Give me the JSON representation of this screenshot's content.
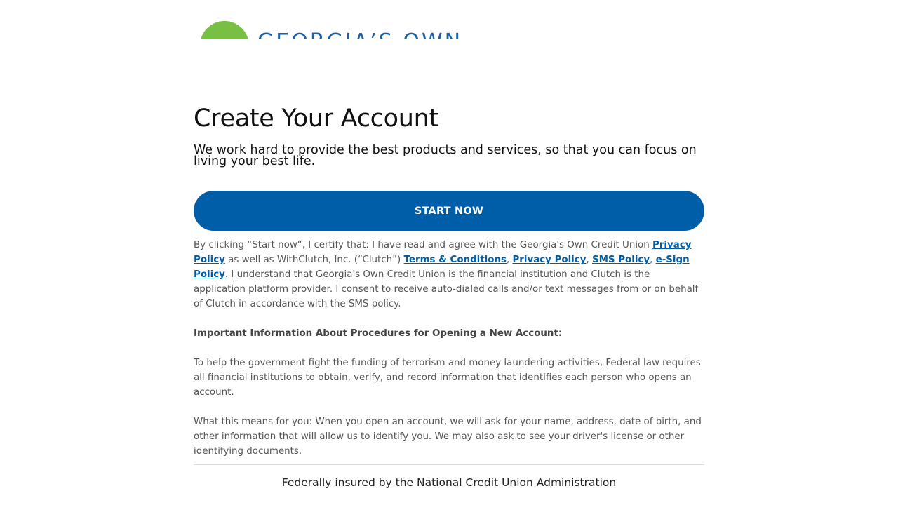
{
  "brand": {
    "logo_text": "GEORGIA’S OWN",
    "logo_circle_color": "#78c043",
    "logo_text_color": "#1d5fa6"
  },
  "page": {
    "title": "Create Your Account",
    "subtitle": "We work hard to provide the best products and services, so that you can focus on living your best life."
  },
  "cta": {
    "label": "START NOW",
    "color": "#005ea8"
  },
  "consent": {
    "text_1": "By clicking “Start now“, I certify that: I have read and agree with the Georgia's Own Credit Union ",
    "link_privacy_gocu": "Privacy Policy",
    "text_2": " as well as WithClutch, Inc. (“Clutch”) ",
    "link_terms": "Terms & Conditions",
    "sep_1": ", ",
    "link_privacy_clutch": "Privacy Policy",
    "sep_2": ", ",
    "link_sms": "SMS Policy",
    "sep_3": ", ",
    "link_esign": "e-Sign Policy",
    "text_3": ". I understand that Georgia's Own Credit Union is the financial institution and Clutch is the application platform provider. I consent to receive auto-dialed calls and/or text messages from or on behalf of Clutch in accordance with the SMS policy."
  },
  "important": {
    "heading": "Important Information About Procedures for Opening a New Account:",
    "paragraph_1": "To help the government fight the funding of terrorism and money laundering activities, Federal law requires all financial institutions to obtain, verify, and record information that identifies each person who opens an account.",
    "paragraph_2": "What this means for you: When you open an account, we will ask for your name, address, date of birth, and other information that will allow us to identify you. We may also ask to see your driver's license or other identifying documents."
  },
  "footer": {
    "text": "Federally insured by the National Credit Union Administration"
  }
}
